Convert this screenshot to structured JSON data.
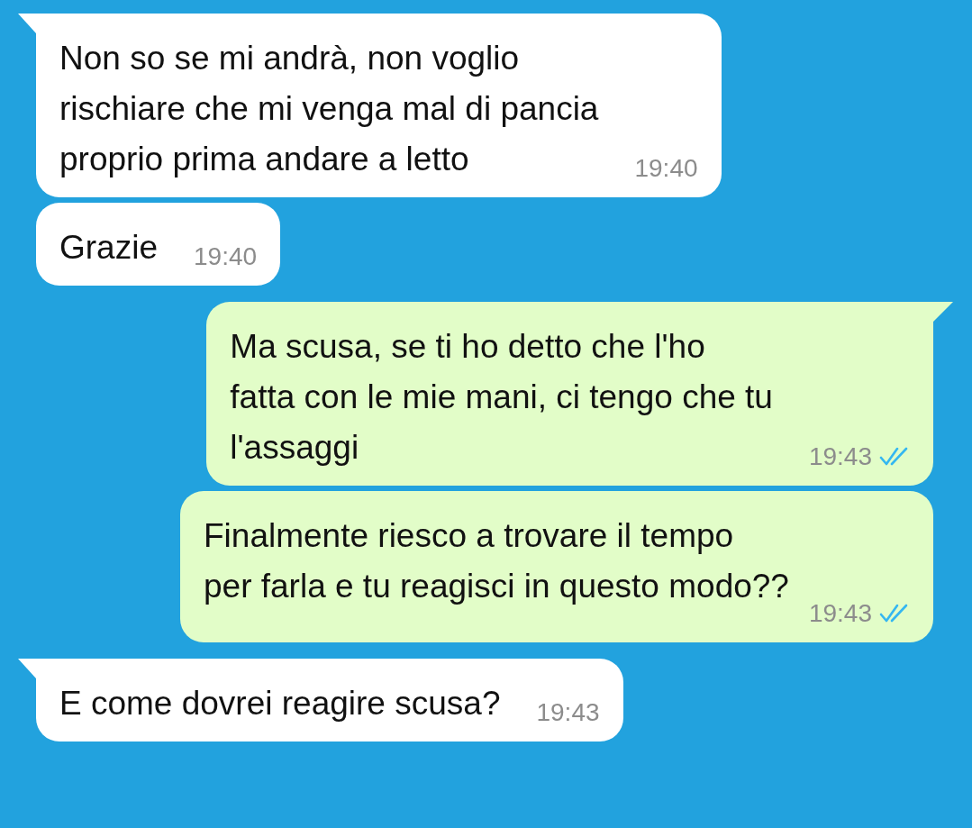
{
  "messages": [
    {
      "kind": "incoming",
      "text": "Non so se mi andrà, non voglio\nrischiare che mi venga mal di pancia\nproprio prima andare a letto",
      "time": "19:40",
      "tail": true
    },
    {
      "kind": "incoming",
      "text": "Grazie",
      "time": "19:40",
      "tail": false
    },
    {
      "kind": "outgoing",
      "text": "Ma scusa, se ti ho detto che l'ho\nfatta con le mie mani, ci tengo che tu\nl'assaggi",
      "time": "19:43",
      "tail": true,
      "read": true
    },
    {
      "kind": "outgoing",
      "text": "Finalmente riesco a trovare il tempo\nper farla e tu reagisci in questo modo??",
      "time": "19:43",
      "tail": false,
      "read": true
    },
    {
      "kind": "incoming",
      "text": "E come dovrei reagire scusa?",
      "time": "19:43",
      "tail": true
    }
  ]
}
